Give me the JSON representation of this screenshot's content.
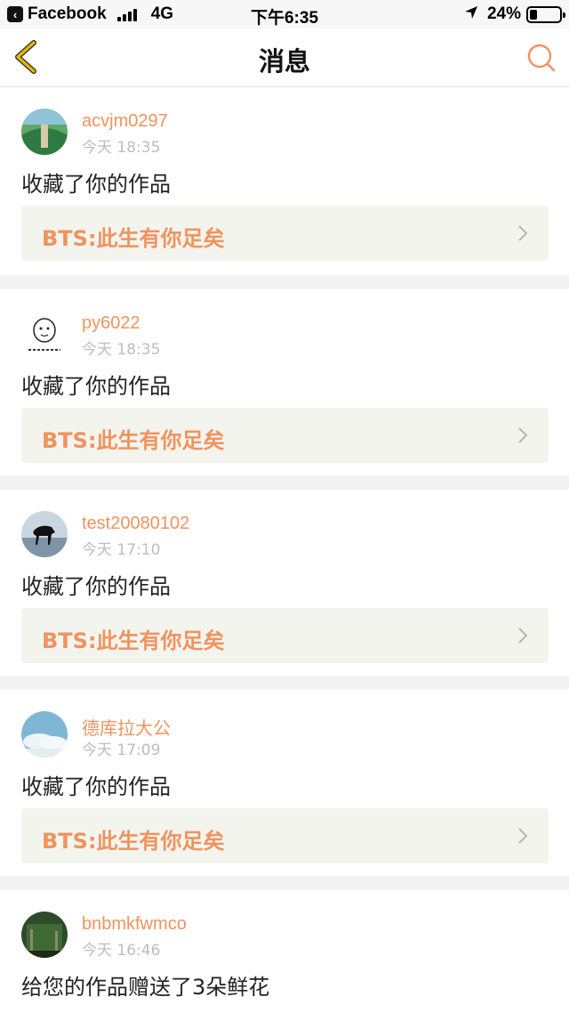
{
  "status_bar": {
    "back_app": "Facebook",
    "network": "4G",
    "time": "下午6:35",
    "battery": "24%",
    "battery_level": 0.24
  },
  "nav": {
    "title": "消息",
    "back_icon": "chevron-left-icon",
    "search_icon": "search-icon"
  },
  "colors": {
    "accent": "#f0935e",
    "back_arrow": "#e8b800",
    "link_bg": "#f4f4ee"
  },
  "messages": [
    {
      "username": "acvjm0297",
      "time": "今天 18:35",
      "action": "收藏了你的作品",
      "work": "BTS:此生有你足矣"
    },
    {
      "username": "py6022",
      "time": "今天 18:35",
      "action": "收藏了你的作品",
      "work": "BTS:此生有你足矣"
    },
    {
      "username": "test20080102",
      "time": "今天 17:10",
      "action": "收藏了你的作品",
      "work": "BTS:此生有你足矣"
    },
    {
      "username": "德库拉大公",
      "time": "今天 17:09",
      "action": "收藏了你的作品",
      "work": "BTS:此生有你足矣"
    },
    {
      "username": "bnbmkfwmco",
      "time": "今天 16:46",
      "action": "给您的作品赠送了3朵鲜花"
    }
  ]
}
